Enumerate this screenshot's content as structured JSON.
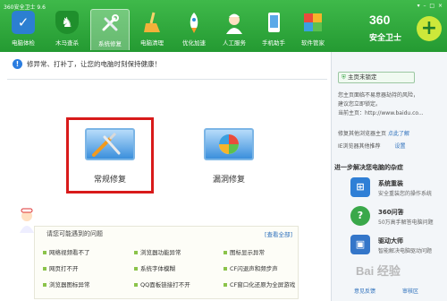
{
  "app": {
    "title": "360安全卫士 9.6",
    "brand_number": "360",
    "brand_name": "安全卫士",
    "window_controls": "▾ – □ ×"
  },
  "nav": [
    {
      "label": "电脑体检",
      "icon": "monitor-check-icon"
    },
    {
      "label": "木马查杀",
      "icon": "shield-horse-icon"
    },
    {
      "label": "系统修复",
      "icon": "wrench-screwdriver-icon"
    },
    {
      "label": "电脑清理",
      "icon": "broom-icon"
    },
    {
      "label": "优化加速",
      "icon": "rocket-icon"
    },
    {
      "label": "人工服务",
      "icon": "support-agent-icon"
    },
    {
      "label": "手机助手",
      "icon": "phone-icon"
    },
    {
      "label": "软件管家",
      "icon": "software-box-icon"
    }
  ],
  "nav_active_index": 2,
  "main": {
    "tip": "修异常、打补丁，让您的电脑时刻保持健康！",
    "tools": [
      {
        "label": "常规修复",
        "icon": "regular-repair-icon"
      },
      {
        "label": "漏洞修复",
        "icon": "vulnerability-repair-icon"
      }
    ],
    "faq": {
      "title": "请您可能遇到的问题",
      "view_all": "[查看全部]",
      "items": [
        "网络视频看不了",
        "浏览器功能异常",
        "图标显示异常",
        "网页打不开",
        "系统字体模糊",
        "CF闪退声和频步声",
        "浏览器图标异常",
        "QQ面板链接打不开",
        "CF窗口化还原为全屏游戏"
      ]
    }
  },
  "right": {
    "lock_button": "主页未锁定",
    "info": [
      "您主页面临不易意器劫持的风险，",
      "建议您立即锁定。",
      "当前主页：http://www.baidu.co..."
    ],
    "links": [
      {
        "text": "修复其他浏览器主页",
        "action": "点此了解"
      },
      {
        "text": "IE浏览器其他推荐",
        "action": "设置"
      }
    ],
    "section_title": "进一步解决您电脑的杂症",
    "services": [
      {
        "title": "系统重装",
        "desc": "安全重装您的操作系统",
        "icon": "windows-logo-icon",
        "color": "#2f7fd6"
      },
      {
        "title": "360问答",
        "desc": "50万高手解答电脑问题",
        "icon": "qa-bubble-icon",
        "color": "#3aa84a"
      },
      {
        "title": "驱动大师",
        "desc": "智能解决电脑驱动问题",
        "icon": "driver-chip-icon",
        "color": "#3476c9"
      }
    ],
    "footer": [
      "意见反馈",
      "审核区"
    ]
  },
  "watermark": "Bai 经验"
}
